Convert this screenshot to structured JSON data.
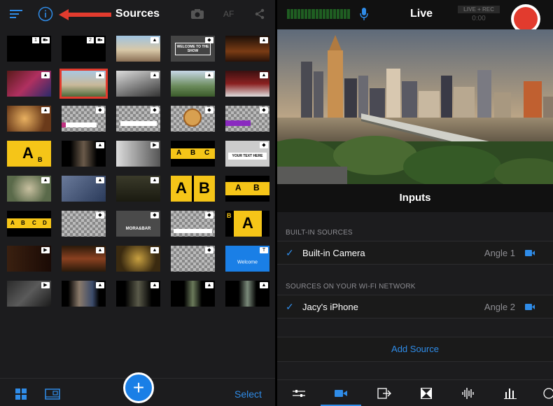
{
  "left": {
    "title": "Sources",
    "af_label": "AF",
    "select_label": "Select",
    "add_label": "+",
    "tile_numbers": [
      "1",
      "2"
    ],
    "tile_text": {
      "welcome": "WELCOME TO THE SHOW",
      "your_text_here": "YOUR TEXT HERE",
      "welcome_blue": "Welcome",
      "morabar": "MORA&BAR",
      "abc": [
        "A",
        "B",
        "C",
        "D"
      ]
    }
  },
  "right": {
    "title": "Live",
    "record_label": "LIVE + REC",
    "record_time": "0:00",
    "inputs_title": "Inputs",
    "builtin_section": "BUILT-IN SOURCES",
    "wifi_section": "SOURCES ON YOUR WI-FI NETWORK",
    "sources": [
      {
        "name": "Built-in Camera",
        "angle": "Angle 1"
      },
      {
        "name": "Jacy's iPhone",
        "angle": "Angle 2"
      }
    ],
    "add_source_label": "Add Source",
    "checkmark": "✓"
  },
  "colors": {
    "accent": "#2f8ce8",
    "record": "#e23b2e",
    "panel": "#1c1c1e",
    "yellow_tile": "#f5c518"
  }
}
